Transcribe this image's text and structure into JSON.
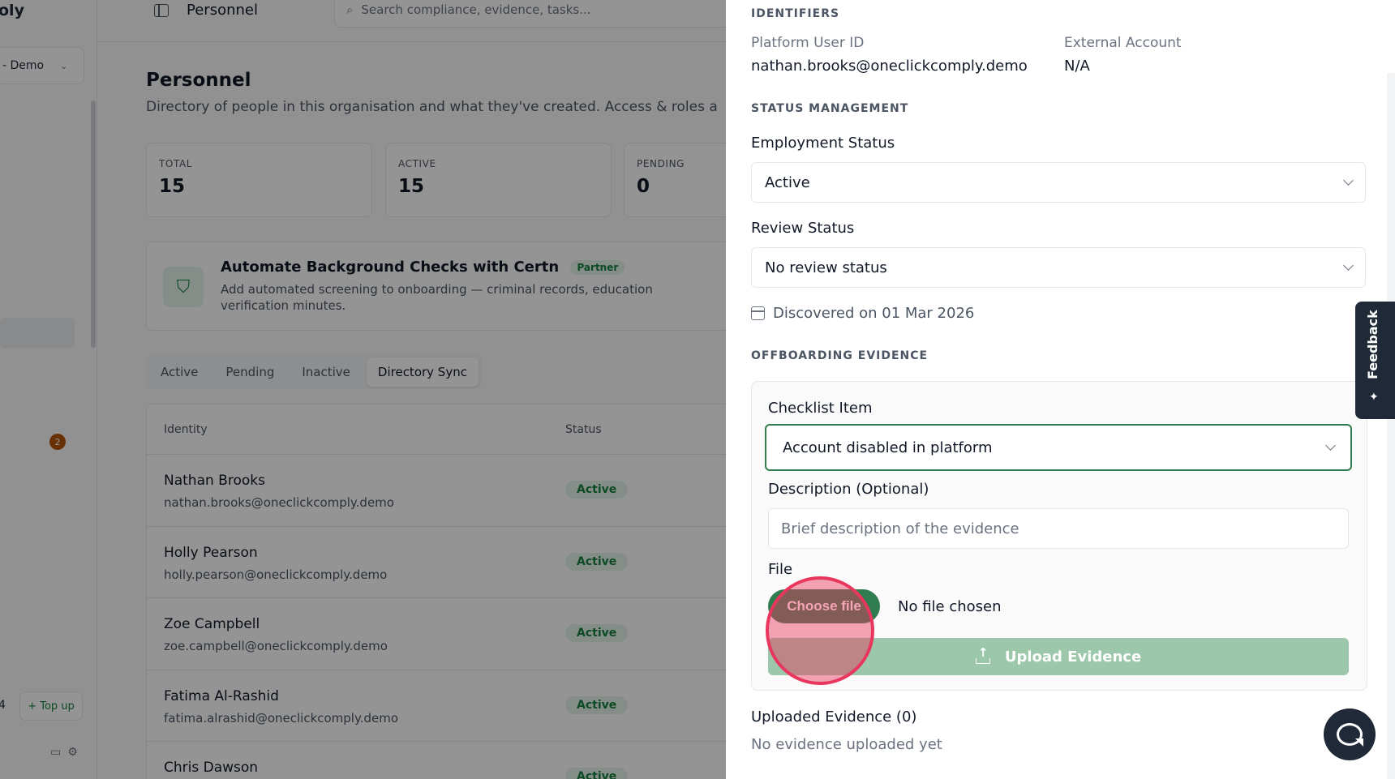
{
  "sidebar": {
    "brand": "oly",
    "org_select": "- Demo",
    "badge_count": "2",
    "credits": "4",
    "topup_label": "+ Top up"
  },
  "topbar": {
    "title": "Personnel",
    "search_placeholder": "Search compliance, evidence, tasks..."
  },
  "page": {
    "title": "Personnel",
    "subtitle": "Directory of people in this organisation and what they've created. Access & roles a"
  },
  "stats": [
    {
      "label": "TOTAL",
      "value": "15"
    },
    {
      "label": "ACTIVE",
      "value": "15"
    },
    {
      "label": "PENDING",
      "value": "0"
    }
  ],
  "promo": {
    "title": "Automate Background Checks with Certn",
    "badge": "Partner",
    "description": "Add automated screening to onboarding — criminal records, education verification minutes."
  },
  "tabs": [
    "Active",
    "Pending",
    "Inactive",
    "Directory Sync"
  ],
  "active_tab": "Directory Sync",
  "table": {
    "columns": [
      "Identity",
      "Status"
    ],
    "rows": [
      {
        "name": "Nathan Brooks",
        "email": "nathan.brooks@oneclickcomply.demo",
        "status": "Active"
      },
      {
        "name": "Holly Pearson",
        "email": "holly.pearson@oneclickcomply.demo",
        "status": "Active"
      },
      {
        "name": "Zoe Campbell",
        "email": "zoe.campbell@oneclickcomply.demo",
        "status": "Active"
      },
      {
        "name": "Fatima Al-Rashid",
        "email": "fatima.alrashid@oneclickcomply.demo",
        "status": "Active"
      },
      {
        "name": "Chris Dawson",
        "email": "",
        "status": "Active"
      }
    ]
  },
  "drawer": {
    "identifiers": {
      "heading": "IDENTIFIERS",
      "platform_user_id_label": "Platform User ID",
      "platform_user_id": "nathan.brooks@oneclickcomply.demo",
      "external_account_label": "External Account",
      "external_account": "N/A"
    },
    "status": {
      "heading": "STATUS MANAGEMENT",
      "employment_label": "Employment Status",
      "employment_value": "Active",
      "review_label": "Review Status",
      "review_value": "No review status",
      "discovered": "Discovered on 01 Mar 2026"
    },
    "offboarding": {
      "heading": "OFFBOARDING EVIDENCE",
      "checklist_label": "Checklist Item",
      "checklist_value": "Account disabled in platform",
      "description_label": "Description (Optional)",
      "description_placeholder": "Brief description of the evidence",
      "file_label": "File",
      "choose_file": "Choose file",
      "no_file": "No file chosen",
      "upload_label": "Upload Evidence"
    },
    "uploaded": {
      "label": "Uploaded Evidence (0)",
      "empty": "No evidence uploaded yet"
    }
  },
  "feedback_label": "Feedback",
  "colors": {
    "accent_green": "#2f7d4f",
    "disabled_green": "#9cc7aa",
    "click_indicator": "#e8365d"
  }
}
